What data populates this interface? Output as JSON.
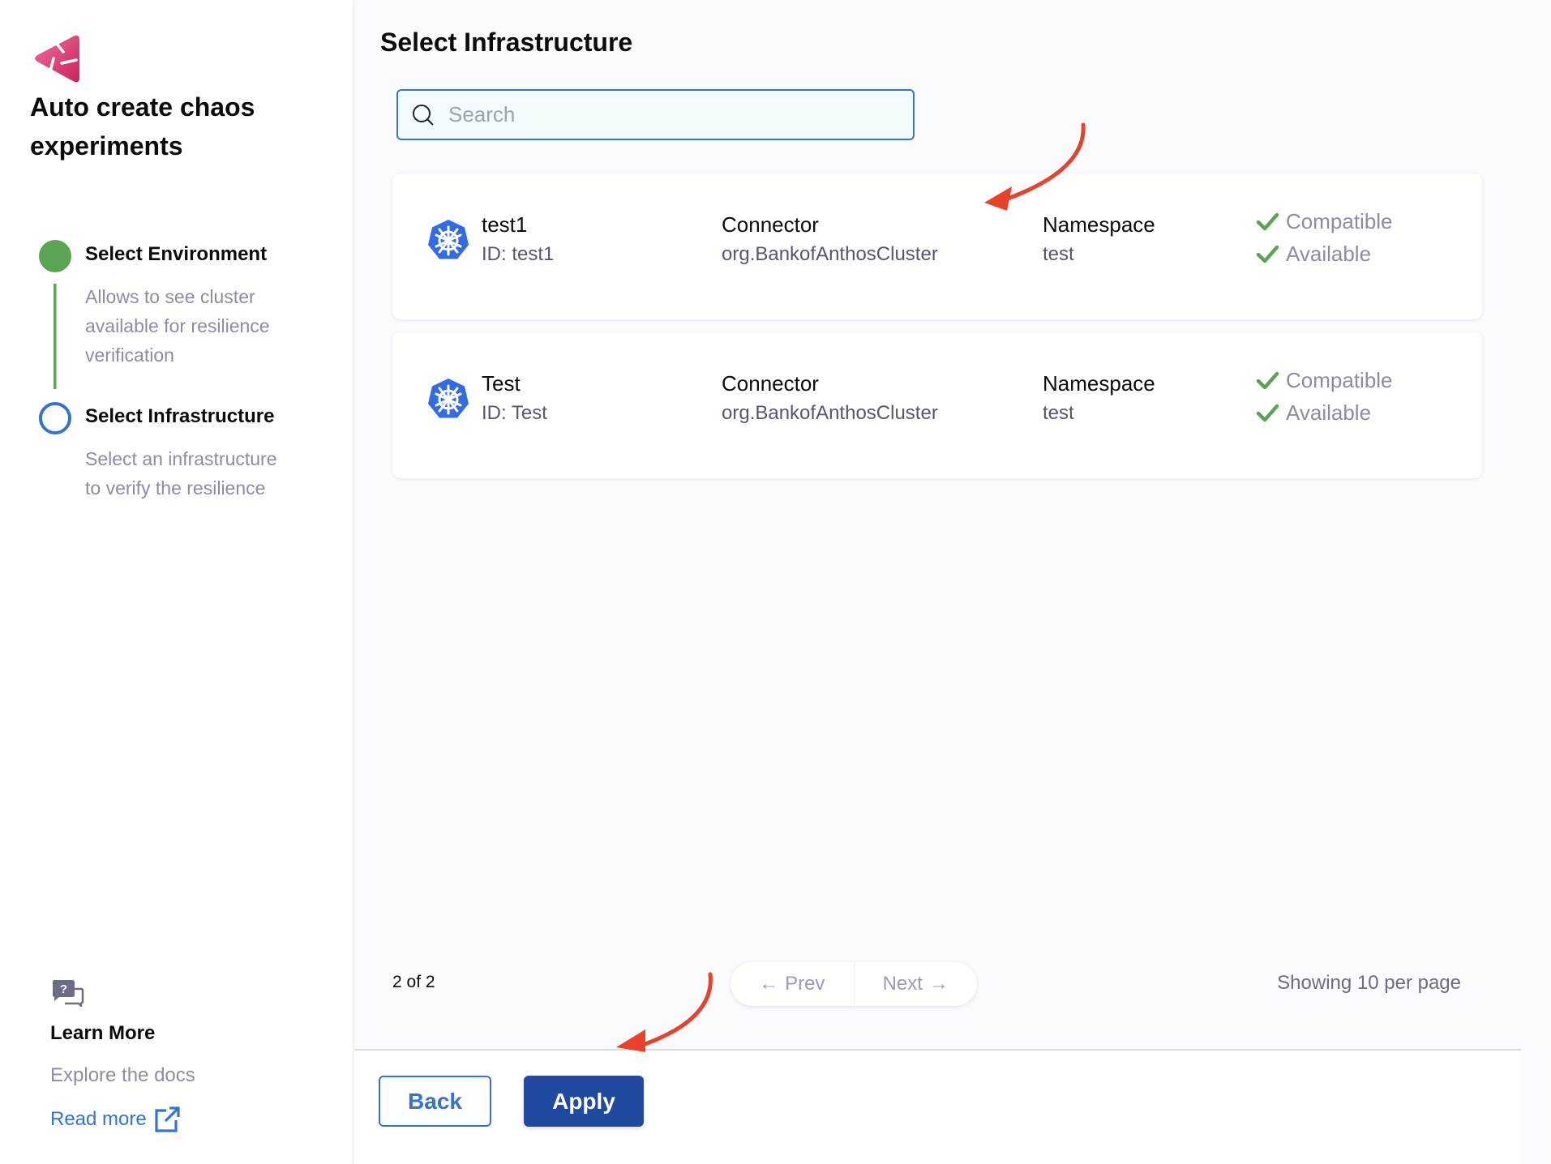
{
  "sidebar": {
    "title": "Auto create chaos experiments",
    "steps": [
      {
        "label": "Select Environment",
        "description": "Allows to see cluster available for resilience verification",
        "state": "completed"
      },
      {
        "label": "Select Infrastructure",
        "description": "Select an infrastructure to verify the resilience",
        "state": "current"
      }
    ],
    "learn_more": {
      "title": "Learn More",
      "subtitle": "Explore the docs",
      "link_label": "Read more"
    }
  },
  "main": {
    "title": "Select Infrastructure",
    "search": {
      "placeholder": "Search",
      "value": ""
    },
    "infrastructures": [
      {
        "name": "test1",
        "id_label": "ID: test1",
        "connector_header": "Connector",
        "connector": "org.BankofAnthosCluster",
        "namespace_header": "Namespace",
        "namespace": "test",
        "statuses": [
          "Compatible",
          "Available"
        ]
      },
      {
        "name": "Test",
        "id_label": "ID: Test",
        "connector_header": "Connector",
        "connector": "org.BankofAnthosCluster",
        "namespace_header": "Namespace",
        "namespace": "test",
        "statuses": [
          "Compatible",
          "Available"
        ]
      }
    ],
    "pagination": {
      "count_label": "2 of 2",
      "prev_label": "Prev",
      "next_label": "Next",
      "per_page_label": "Showing 10 per page"
    }
  },
  "footer": {
    "back_label": "Back",
    "apply_label": "Apply"
  },
  "colors": {
    "primary": "#1f4a9e",
    "accent_blue": "#3474d0",
    "success_green": "#5aa454",
    "annotation_red": "#e8432a",
    "brand_pink": "#e2457a",
    "kubernetes_blue": "#326ce5"
  }
}
